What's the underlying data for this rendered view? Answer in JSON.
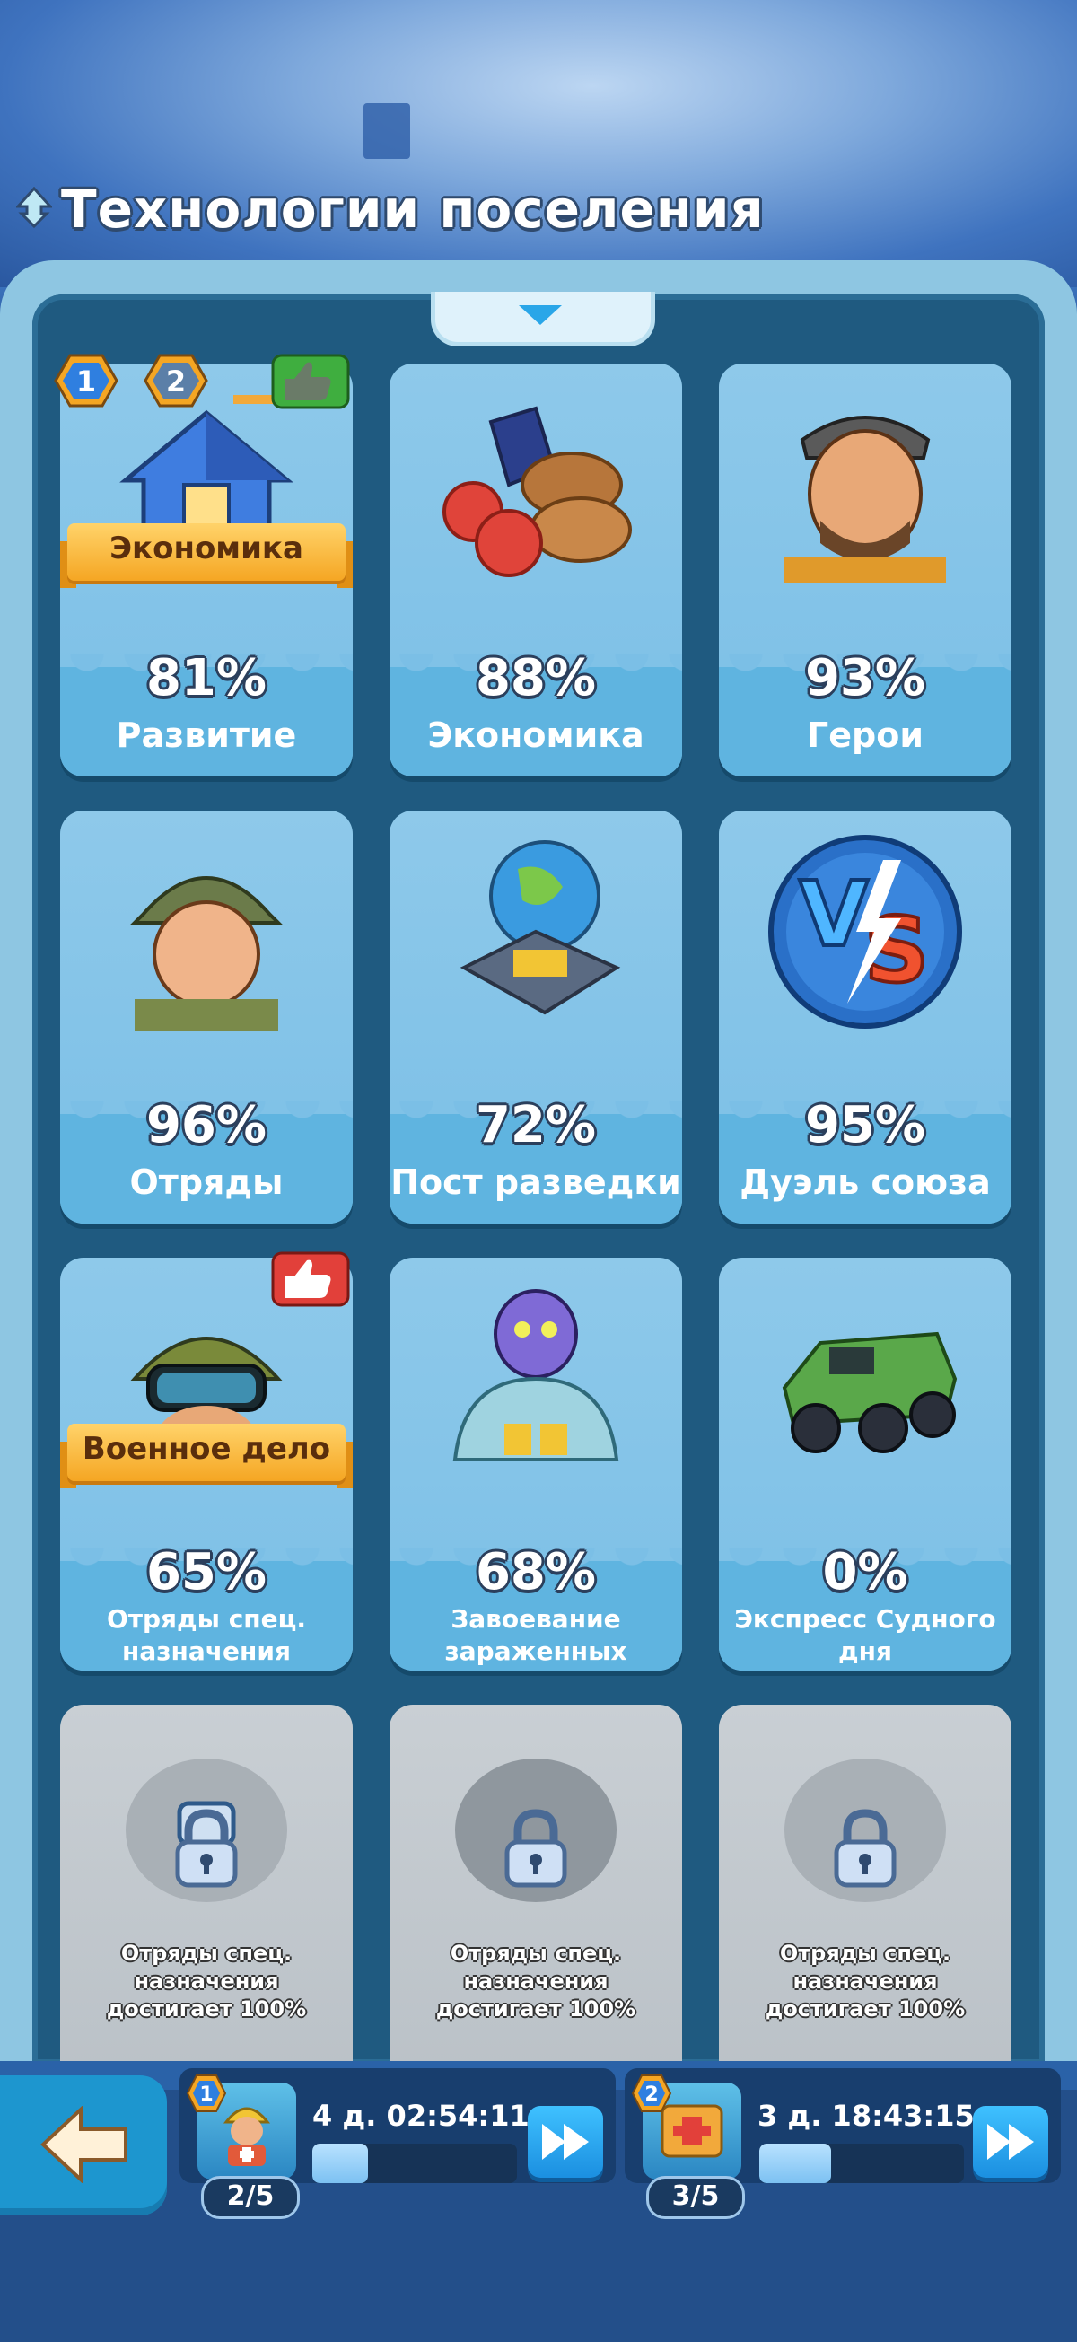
{
  "title": "Технологии поселения",
  "cards": [
    {
      "name": "Развитие",
      "percent": "81%",
      "ribbon": "Экономика",
      "badges": [
        "1",
        "2"
      ]
    },
    {
      "name": "Экономика",
      "percent": "88%"
    },
    {
      "name": "Герои",
      "percent": "93%"
    },
    {
      "name": "Отряды",
      "percent": "96%"
    },
    {
      "name": "Пост разведки",
      "percent": "72%"
    },
    {
      "name": "Дуэль союза",
      "percent": "95%"
    },
    {
      "name": "Отряды спец. назначения",
      "percent": "65%",
      "ribbon": "Военное дело"
    },
    {
      "name": "Завоевание зараженных",
      "percent": "68%"
    },
    {
      "name": "Экспресс Судного дня",
      "percent": "0%"
    }
  ],
  "locked_cards": [
    {
      "text": "Отряды спец. назначения достигает 100%"
    },
    {
      "text": "Отряды спец. назначения достигает 100%"
    },
    {
      "text": "Отряды спец. назначения достигает 100%"
    }
  ],
  "queues": [
    {
      "badge": "1",
      "count": "2/5",
      "timer": "4 д. 02:54:11",
      "progress": 0.27
    },
    {
      "badge": "2",
      "count": "3/5",
      "timer": "3 д. 18:43:15",
      "progress": 0.35
    }
  ],
  "colors": {
    "accent": "#1d96cf",
    "ribbon": "#f5a623",
    "card": "#7bbfe6",
    "board": "#1f5a80"
  }
}
